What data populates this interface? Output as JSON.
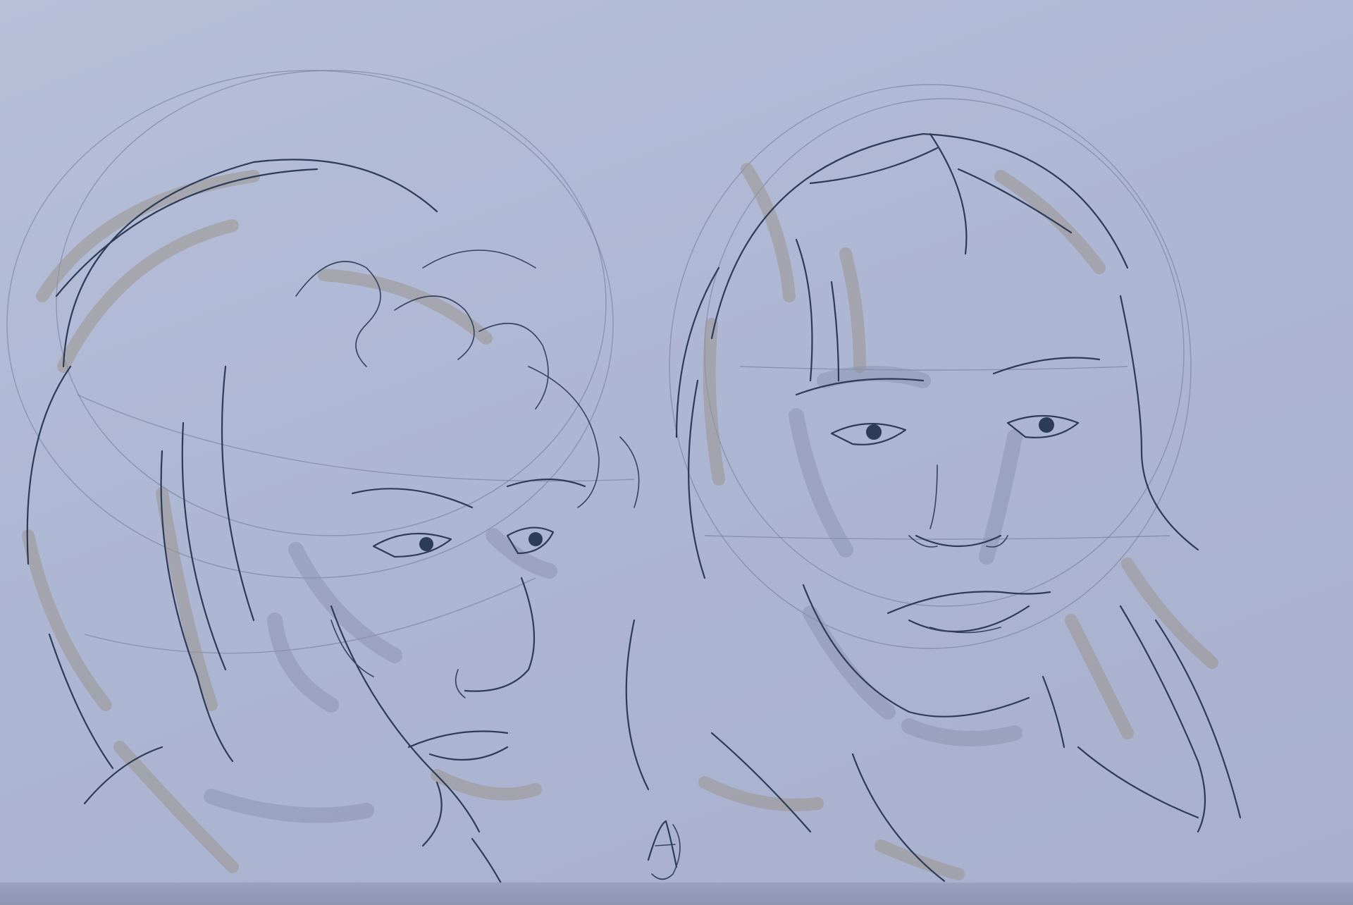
{
  "image": {
    "subject": "",
    "signature_glyph": "AJ"
  },
  "palette": {
    "paper": "#b0b8d4",
    "ink": "#2c3b57",
    "warm_marker": "#9a958e",
    "cool_marker": "#8a92ae"
  }
}
